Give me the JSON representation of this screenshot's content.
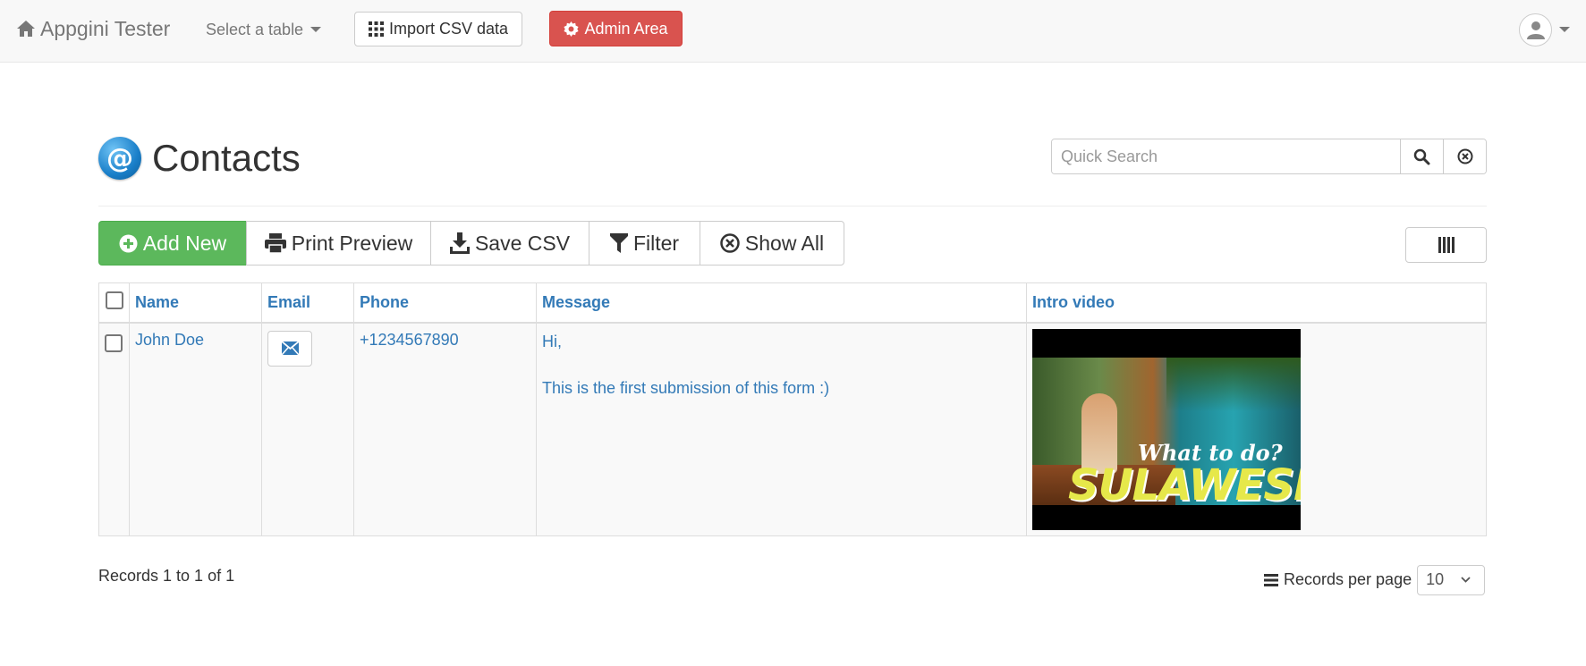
{
  "navbar": {
    "brand": "Appgini Tester",
    "select_table": "Select a table",
    "import_label": "Import CSV data",
    "admin_label": "Admin Area",
    "admin_color": "#d9534f"
  },
  "page": {
    "title": "Contacts",
    "search_placeholder": "Quick Search"
  },
  "toolbar": {
    "add_new": "Add New",
    "print_preview": "Print Preview",
    "save_csv": "Save CSV",
    "filter": "Filter",
    "show_all": "Show All",
    "add_color": "#5cb85c"
  },
  "table": {
    "columns": [
      "Name",
      "Email",
      "Phone",
      "Message",
      "Intro video"
    ],
    "rows": [
      {
        "name": "John Doe",
        "phone": "+1234567890",
        "message_line1": "Hi,",
        "message_line2": "This is the first submission of this form :)",
        "video_title_top": "What to do?",
        "video_title_main": "SULAWESI"
      }
    ]
  },
  "footer": {
    "records_info": "Records 1 to 1 of 1",
    "per_page_label": "Records per page",
    "per_page_value": "10"
  },
  "icons": {
    "brand": "home-icon",
    "import": "grid-icon",
    "admin": "gear-icon",
    "user": "user-icon",
    "search": "search-icon",
    "clear": "close-circle-icon",
    "add": "plus-circle-icon",
    "print": "print-icon",
    "save": "download-icon",
    "filter": "filter-icon",
    "show_all": "close-circle-icon",
    "columns": "columns-icon",
    "email": "envelope-icon",
    "per_page": "list-icon"
  }
}
